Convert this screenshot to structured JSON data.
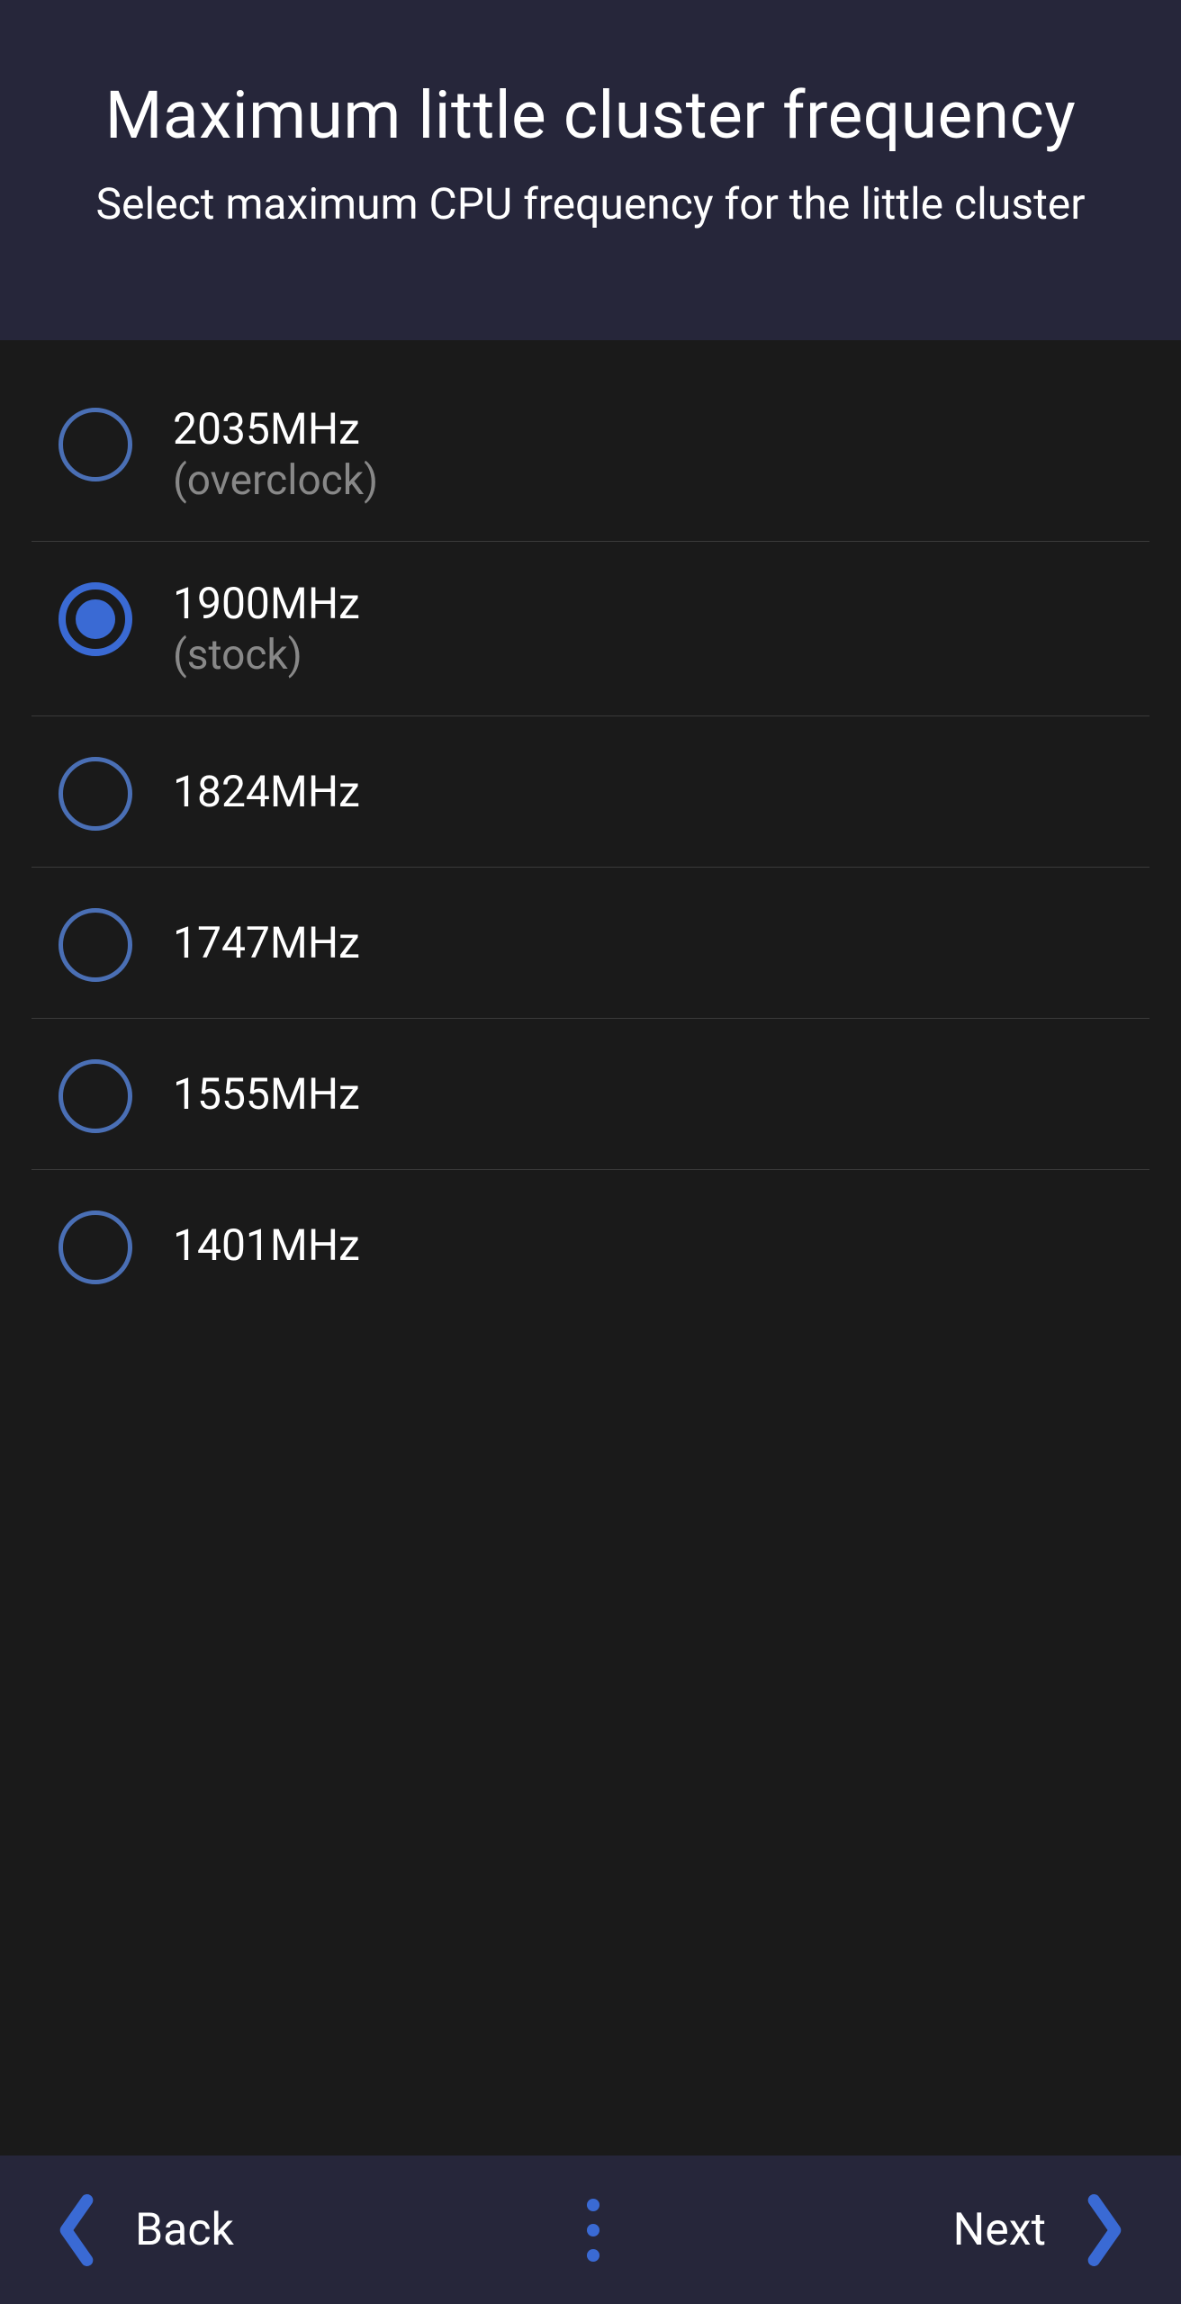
{
  "header": {
    "title": "Maximum little cluster frequency",
    "subtitle": "Select maximum CPU frequency for the little cluster"
  },
  "options": [
    {
      "label": "2035MHz",
      "sublabel": "(overclock)",
      "selected": false
    },
    {
      "label": "1900MHz",
      "sublabel": "(stock)",
      "selected": true
    },
    {
      "label": "1824MHz",
      "sublabel": "",
      "selected": false
    },
    {
      "label": "1747MHz",
      "sublabel": "",
      "selected": false
    },
    {
      "label": "1555MHz",
      "sublabel": "",
      "selected": false
    },
    {
      "label": "1401MHz",
      "sublabel": "",
      "selected": false
    }
  ],
  "footer": {
    "back_label": "Back",
    "next_label": "Next"
  }
}
